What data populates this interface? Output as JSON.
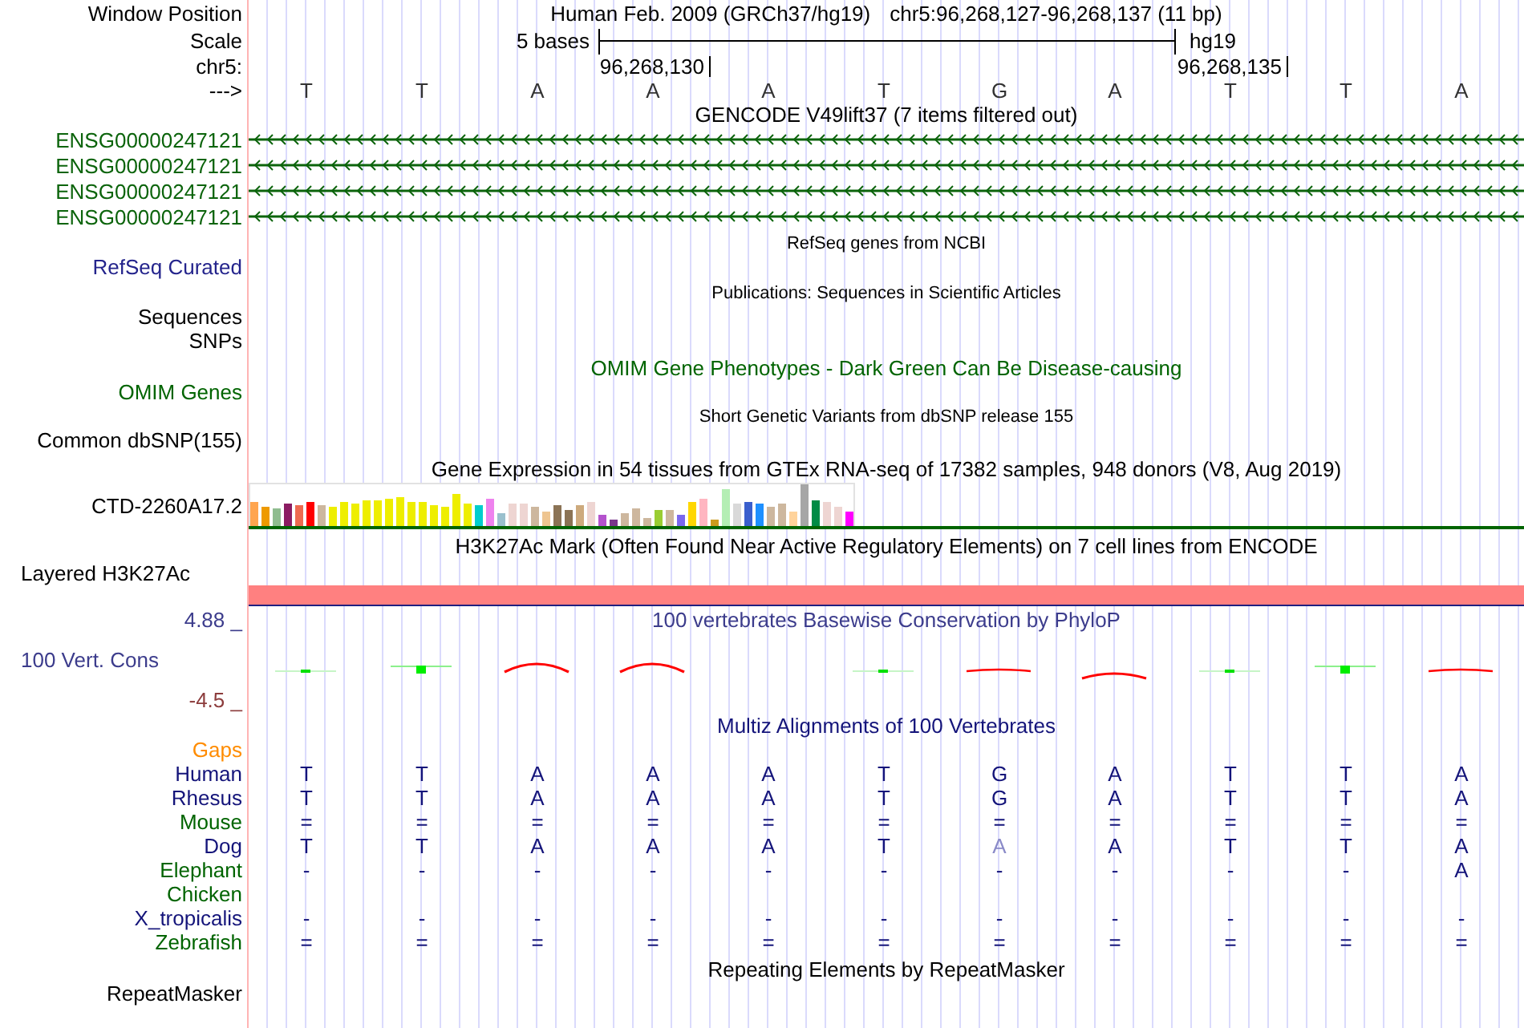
{
  "position": {
    "label": "Window Position",
    "assembly": "Human Feb. 2009 (GRCh37/hg19)",
    "range": "chr5:96,268,127-96,268,137 (11 bp)"
  },
  "scale": {
    "label": "Scale",
    "length": "5 bases",
    "assembly": "hg19"
  },
  "ruler": {
    "label": "chr5:"
  },
  "sequence": {
    "label": "--->",
    "bases": [
      {
        "base": "T"
      },
      {
        "base": "T"
      },
      {
        "base": "A"
      },
      {
        "base": "A",
        "tick": "96,268,130"
      },
      {
        "base": "A"
      },
      {
        "base": "T"
      },
      {
        "base": "G"
      },
      {
        "base": "A"
      },
      {
        "base": "T",
        "tick": "96,268,135"
      },
      {
        "base": "T"
      },
      {
        "base": "A"
      }
    ]
  },
  "tracks": [
    {
      "kind": "genes",
      "title": {
        "text": "GENCODE V49lift37 (7 items filtered out)",
        "color": "#000000"
      },
      "rows": [
        {
          "label": "ENSG00000247121",
          "color": "#0c640c",
          "reverse": true
        },
        {
          "label": "ENSG00000247121",
          "color": "#0c640c",
          "reverse": true
        },
        {
          "label": "ENSG00000247121",
          "color": "#0c640c",
          "reverse": true
        },
        {
          "label": "ENSG00000247121",
          "color": "#0c640c",
          "reverse": true
        }
      ]
    },
    {
      "kind": "empty",
      "title": {
        "text": "RefSeq genes from NCBI",
        "color": "#000000"
      },
      "rows": [
        {
          "label": "RefSeq Curated",
          "color": "#24248c"
        }
      ]
    },
    {
      "kind": "empty",
      "title": {
        "text": "Publications: Sequences in Scientific Articles",
        "color": "#000000"
      },
      "rows": [
        {
          "label": "Sequences",
          "color": "#000000"
        },
        {
          "label": "SNPs",
          "color": "#000000"
        }
      ]
    },
    {
      "kind": "dense",
      "title": {
        "text": "OMIM Gene Phenotypes - Dark Green Can Be Disease-causing",
        "color": "#006400"
      },
      "rows": [
        {
          "label": "OMIM Genes",
          "color": "#006400"
        }
      ]
    },
    {
      "kind": "empty",
      "title": {
        "text": "Short Genetic Variants from dbSNP release 155",
        "color": "#000000"
      },
      "rows": [
        {
          "label": "Common dbSNP(155)",
          "color": "#000000"
        }
      ]
    },
    {
      "kind": "bar_chart",
      "title": {
        "text": "Gene Expression in 54 tissues from GTEx RNA-seq of 17382 samples, 948 donors (V8, Aug 2019)",
        "color": "#000000"
      },
      "rows": [
        {
          "label": "CTD-2260A17.2",
          "color": "#000000"
        }
      ]
    },
    {
      "kind": "signal",
      "title": {
        "text": "H3K27Ac Mark (Often Found Near Active Regulatory Elements) on 7 cell lines from ENCODE",
        "color": "#000000"
      },
      "rows": [
        {
          "label": "Layered H3K27Ac",
          "color": "#000000"
        }
      ]
    },
    {
      "kind": "wiggle",
      "title": {
        "text": "100 vertebrates Basewise Conservation by PhyloP",
        "color": "#3c3c8c"
      },
      "axis": {
        "max": "4.88 _",
        "min": "-4.5 _"
      },
      "rows": [
        {
          "label": "100 Vert. Cons",
          "color": "#3c3c8c"
        }
      ],
      "marks": [
        {
          "kind": "weak_positive"
        },
        {
          "kind": "positive"
        },
        {
          "kind": "negative_arc"
        },
        {
          "kind": "negative_arc"
        },
        {
          "kind": "none"
        },
        {
          "kind": "weak_positive"
        },
        {
          "kind": "negative_flat"
        },
        {
          "kind": "negative_low"
        },
        {
          "kind": "weak_positive"
        },
        {
          "kind": "positive"
        },
        {
          "kind": "negative_flat"
        }
      ]
    },
    {
      "kind": "alignment",
      "title": {
        "text": "Multiz Alignments of 100 Vertebrates",
        "color": "#14147a"
      },
      "rows": [
        {
          "label": "Gaps",
          "color": "#ff8c00"
        },
        {
          "label": "Human",
          "color": "#14147a",
          "bases": [
            {
              "base": "T",
              "dim": false
            },
            {
              "base": "T",
              "dim": false
            },
            {
              "base": "A",
              "dim": false
            },
            {
              "base": "A",
              "dim": false
            },
            {
              "base": "A",
              "dim": false
            },
            {
              "base": "T",
              "dim": false
            },
            {
              "base": "G",
              "dim": false
            },
            {
              "base": "A",
              "dim": false
            },
            {
              "base": "T",
              "dim": false
            },
            {
              "base": "T",
              "dim": false
            },
            {
              "base": "A",
              "dim": false
            }
          ]
        },
        {
          "label": "Rhesus",
          "color": "#14147a",
          "bases": [
            {
              "base": "T",
              "dim": false
            },
            {
              "base": "T",
              "dim": false
            },
            {
              "base": "A",
              "dim": false
            },
            {
              "base": "A",
              "dim": false
            },
            {
              "base": "A",
              "dim": false
            },
            {
              "base": "T",
              "dim": false
            },
            {
              "base": "G",
              "dim": false
            },
            {
              "base": "A",
              "dim": false
            },
            {
              "base": "T",
              "dim": false
            },
            {
              "base": "T",
              "dim": false
            },
            {
              "base": "A",
              "dim": false
            }
          ]
        },
        {
          "label": "Mouse",
          "color": "#006400",
          "bases": [
            {
              "base": "=",
              "dim": false
            },
            {
              "base": "=",
              "dim": false
            },
            {
              "base": "=",
              "dim": false
            },
            {
              "base": "=",
              "dim": false
            },
            {
              "base": "=",
              "dim": false
            },
            {
              "base": "=",
              "dim": false
            },
            {
              "base": "=",
              "dim": false
            },
            {
              "base": "=",
              "dim": false
            },
            {
              "base": "=",
              "dim": false
            },
            {
              "base": "=",
              "dim": false
            },
            {
              "base": "=",
              "dim": false
            }
          ]
        },
        {
          "label": "Dog",
          "color": "#14147a",
          "bases": [
            {
              "base": "T",
              "dim": false
            },
            {
              "base": "T",
              "dim": false
            },
            {
              "base": "A",
              "dim": false
            },
            {
              "base": "A",
              "dim": false
            },
            {
              "base": "A",
              "dim": false
            },
            {
              "base": "T",
              "dim": false
            },
            {
              "base": "A",
              "dim": true
            },
            {
              "base": "A",
              "dim": false
            },
            {
              "base": "T",
              "dim": false
            },
            {
              "base": "T",
              "dim": false
            },
            {
              "base": "A",
              "dim": false
            }
          ]
        },
        {
          "label": "Elephant",
          "color": "#006400",
          "bases": [
            {
              "base": "-",
              "dim": false
            },
            {
              "base": "-",
              "dim": false
            },
            {
              "base": "-",
              "dim": false
            },
            {
              "base": "-",
              "dim": false
            },
            {
              "base": "-",
              "dim": false
            },
            {
              "base": "-",
              "dim": false
            },
            {
              "base": "-",
              "dim": false
            },
            {
              "base": "-",
              "dim": false
            },
            {
              "base": "-",
              "dim": false
            },
            {
              "base": "-",
              "dim": false
            },
            {
              "base": "A",
              "dim": false
            }
          ]
        },
        {
          "label": "Chicken",
          "color": "#006400"
        },
        {
          "label": "X_tropicalis",
          "color": "#14147a",
          "bases": [
            {
              "base": "-",
              "dim": false
            },
            {
              "base": "-",
              "dim": false
            },
            {
              "base": "-",
              "dim": false
            },
            {
              "base": "-",
              "dim": false
            },
            {
              "base": "-",
              "dim": false
            },
            {
              "base": "-",
              "dim": false
            },
            {
              "base": "-",
              "dim": false
            },
            {
              "base": "-",
              "dim": false
            },
            {
              "base": "-",
              "dim": false
            },
            {
              "base": "-",
              "dim": false
            },
            {
              "base": "-",
              "dim": false
            }
          ]
        },
        {
          "label": "Zebrafish",
          "color": "#006400",
          "bases": [
            {
              "base": "=",
              "dim": false
            },
            {
              "base": "=",
              "dim": false
            },
            {
              "base": "=",
              "dim": false
            },
            {
              "base": "=",
              "dim": false
            },
            {
              "base": "=",
              "dim": false
            },
            {
              "base": "=",
              "dim": false
            },
            {
              "base": "=",
              "dim": false
            },
            {
              "base": "=",
              "dim": false
            },
            {
              "base": "=",
              "dim": false
            },
            {
              "base": "=",
              "dim": false
            },
            {
              "base": "=",
              "dim": false
            }
          ]
        }
      ]
    },
    {
      "kind": "dense",
      "title": {
        "text": "Repeating Elements by RepeatMasker",
        "color": "#000000"
      },
      "rows": [
        {
          "label": "RepeatMasker",
          "color": "#000000"
        }
      ]
    }
  ]
}
